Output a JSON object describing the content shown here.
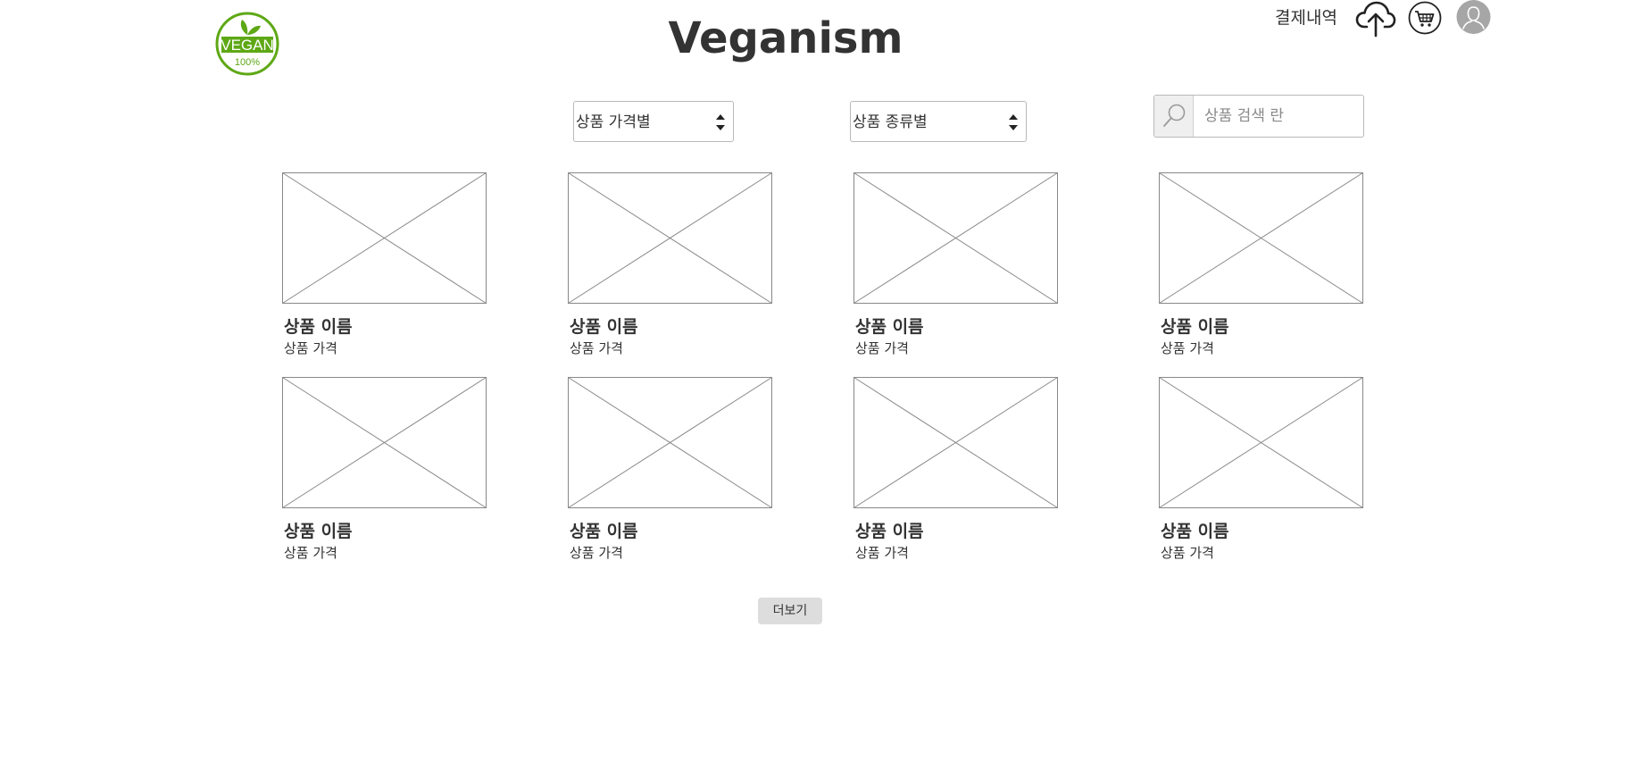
{
  "header": {
    "logo": {
      "badge_text": "VEGAN",
      "badge_subtext": "100%",
      "color": "#5ea815"
    },
    "title": "Veganism",
    "history_link": "결제내역",
    "icons": [
      "cloud-upload-icon",
      "shopping-cart-icon",
      "user-avatar-icon"
    ]
  },
  "filters": {
    "price_select": {
      "label": "상품 가격별"
    },
    "type_select": {
      "label": "상품 종류별"
    },
    "search": {
      "placeholder": "상품 검색 란",
      "value": ""
    }
  },
  "products": [
    {
      "name": "상품 이름",
      "price": "상품 가격"
    },
    {
      "name": "상품 이름",
      "price": "상품 가격"
    },
    {
      "name": "상품 이름",
      "price": "상품 가격"
    },
    {
      "name": "상품 이름",
      "price": "상품 가격"
    },
    {
      "name": "상품 이름",
      "price": "상품 가격"
    },
    {
      "name": "상품 이름",
      "price": "상품 가격"
    },
    {
      "name": "상품 이름",
      "price": "상품 가격"
    },
    {
      "name": "상품 이름",
      "price": "상품 가격"
    }
  ],
  "load_more_label": "더보기",
  "colors": {
    "text": "#333333",
    "border": "#b9b9b9",
    "placeholder_stroke": "#888888",
    "button_bg": "#dddddd",
    "avatar_bg": "#a6a6a6"
  }
}
